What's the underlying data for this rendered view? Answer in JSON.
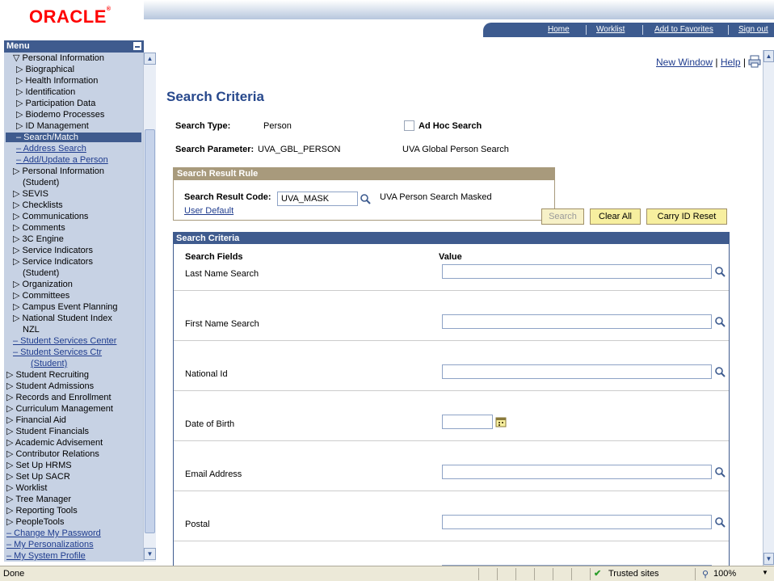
{
  "header": {
    "logo": "ORACLE",
    "nav": [
      "Home",
      "Worklist",
      "Add to Favorites",
      "Sign out"
    ]
  },
  "menu": {
    "title": "Menu",
    "items": [
      {
        "label": "▽ Personal Information",
        "indent": 2,
        "type": "folder"
      },
      {
        "label": "▷ Biographical",
        "indent": 3,
        "type": "folder"
      },
      {
        "label": "▷ Health Information",
        "indent": 3,
        "type": "folder"
      },
      {
        "label": "▷ Identification",
        "indent": 3,
        "type": "folder"
      },
      {
        "label": "▷ Participation Data",
        "indent": 3,
        "type": "folder"
      },
      {
        "label": "▷ Biodemo Processes",
        "indent": 3,
        "type": "folder"
      },
      {
        "label": "▷ ID Management",
        "indent": 3,
        "type": "folder"
      },
      {
        "label": "– Search/Match",
        "indent": 3,
        "type": "selected"
      },
      {
        "label": "– Address Search",
        "indent": 3,
        "type": "link"
      },
      {
        "label": "– Add/Update a Person",
        "indent": 3,
        "type": "link"
      },
      {
        "label": "▷ Personal Information",
        "indent": 2,
        "type": "folder"
      },
      {
        "label": "(Student)",
        "indent": 4,
        "type": "folder"
      },
      {
        "label": "▷ SEVIS",
        "indent": 2,
        "type": "folder"
      },
      {
        "label": "▷ Checklists",
        "indent": 2,
        "type": "folder"
      },
      {
        "label": "▷ Communications",
        "indent": 2,
        "type": "folder"
      },
      {
        "label": "▷ Comments",
        "indent": 2,
        "type": "folder"
      },
      {
        "label": "▷ 3C Engine",
        "indent": 2,
        "type": "folder"
      },
      {
        "label": "▷ Service Indicators",
        "indent": 2,
        "type": "folder"
      },
      {
        "label": "▷ Service Indicators",
        "indent": 2,
        "type": "folder"
      },
      {
        "label": "(Student)",
        "indent": 4,
        "type": "folder"
      },
      {
        "label": "▷ Organization",
        "indent": 2,
        "type": "folder"
      },
      {
        "label": "▷ Committees",
        "indent": 2,
        "type": "folder"
      },
      {
        "label": "▷ Campus Event Planning",
        "indent": 2,
        "type": "folder"
      },
      {
        "label": "▷ National Student Index",
        "indent": 2,
        "type": "folder"
      },
      {
        "label": "NZL",
        "indent": 4,
        "type": "folder"
      },
      {
        "label": "– Student Services Center",
        "indent": 2,
        "type": "link"
      },
      {
        "label": "– Student Services Ctr",
        "indent": 2,
        "type": "link"
      },
      {
        "label": "(Student)",
        "indent": 5,
        "type": "link"
      },
      {
        "label": "▷ Student Recruiting",
        "indent": 0,
        "type": "folder"
      },
      {
        "label": "▷ Student Admissions",
        "indent": 0,
        "type": "folder"
      },
      {
        "label": "▷ Records and Enrollment",
        "indent": 0,
        "type": "folder"
      },
      {
        "label": "▷ Curriculum Management",
        "indent": 0,
        "type": "folder"
      },
      {
        "label": "▷ Financial Aid",
        "indent": 0,
        "type": "folder"
      },
      {
        "label": "▷ Student Financials",
        "indent": 0,
        "type": "folder"
      },
      {
        "label": "▷ Academic Advisement",
        "indent": 0,
        "type": "folder"
      },
      {
        "label": "▷ Contributor Relations",
        "indent": 0,
        "type": "folder"
      },
      {
        "label": "▷ Set Up HRMS",
        "indent": 0,
        "type": "folder"
      },
      {
        "label": "▷ Set Up SACR",
        "indent": 0,
        "type": "folder"
      },
      {
        "label": "▷ Worklist",
        "indent": 0,
        "type": "folder"
      },
      {
        "label": "▷ Tree Manager",
        "indent": 0,
        "type": "folder"
      },
      {
        "label": "▷ Reporting Tools",
        "indent": 0,
        "type": "folder"
      },
      {
        "label": "▷ PeopleTools",
        "indent": 0,
        "type": "folder"
      },
      {
        "label": "– Change My Password",
        "indent": 0,
        "type": "link"
      },
      {
        "label": "– My Personalizations",
        "indent": 0,
        "type": "link"
      },
      {
        "label": "– My System Profile",
        "indent": 0,
        "type": "link"
      }
    ]
  },
  "toplinks": {
    "new_window": "New Window",
    "help": "Help"
  },
  "page": {
    "title": "Search Criteria",
    "search_type_label": "Search Type:",
    "search_type_value": "Person",
    "adhoc_label": "Ad Hoc Search",
    "search_param_label": "Search Parameter:",
    "search_param_value": "UVA_GBL_PERSON",
    "search_param_desc": "UVA Global Person Search"
  },
  "rule": {
    "header": "Search Result Rule",
    "code_label": "Search Result Code:",
    "code_value": "UVA_MASK",
    "code_desc": "UVA Person Search Masked",
    "user_default": "User Default"
  },
  "buttons": {
    "search": "Search",
    "clear_all": "Clear All",
    "carry_reset": "Carry ID Reset"
  },
  "criteria": {
    "header": "Search Criteria",
    "col_fields": "Search Fields",
    "col_value": "Value",
    "fields": [
      {
        "label": "Last Name Search",
        "kind": "lookup"
      },
      {
        "label": "First Name Search",
        "kind": "lookup"
      },
      {
        "label": "National Id",
        "kind": "lookup"
      },
      {
        "label": "Date of Birth",
        "kind": "date"
      },
      {
        "label": "Email Address",
        "kind": "lookup"
      },
      {
        "label": "Postal",
        "kind": "lookup"
      }
    ]
  },
  "status": {
    "left": "Done",
    "zone": "Trusted sites",
    "zoom": "100%"
  }
}
